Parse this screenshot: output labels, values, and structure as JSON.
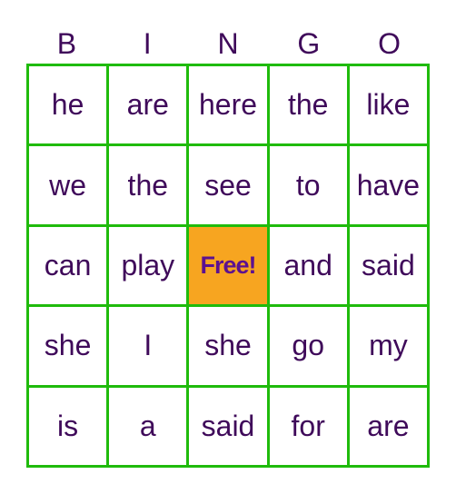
{
  "header": [
    "B",
    "I",
    "N",
    "G",
    "O"
  ],
  "cells": [
    [
      "he",
      "are",
      "here",
      "the",
      "like"
    ],
    [
      "we",
      "the",
      "see",
      "to",
      "have"
    ],
    [
      "can",
      "play",
      "Free!",
      "and",
      "said"
    ],
    [
      "she",
      "I",
      "she",
      "go",
      "my"
    ],
    [
      "is",
      "a",
      "said",
      "for",
      "are"
    ]
  ],
  "free_cell": {
    "row": 2,
    "col": 2
  },
  "colors": {
    "text": "#3f0a5a",
    "grid": "#1fbb0c",
    "free_bg": "#f7a520",
    "free_text": "#5c1190"
  }
}
